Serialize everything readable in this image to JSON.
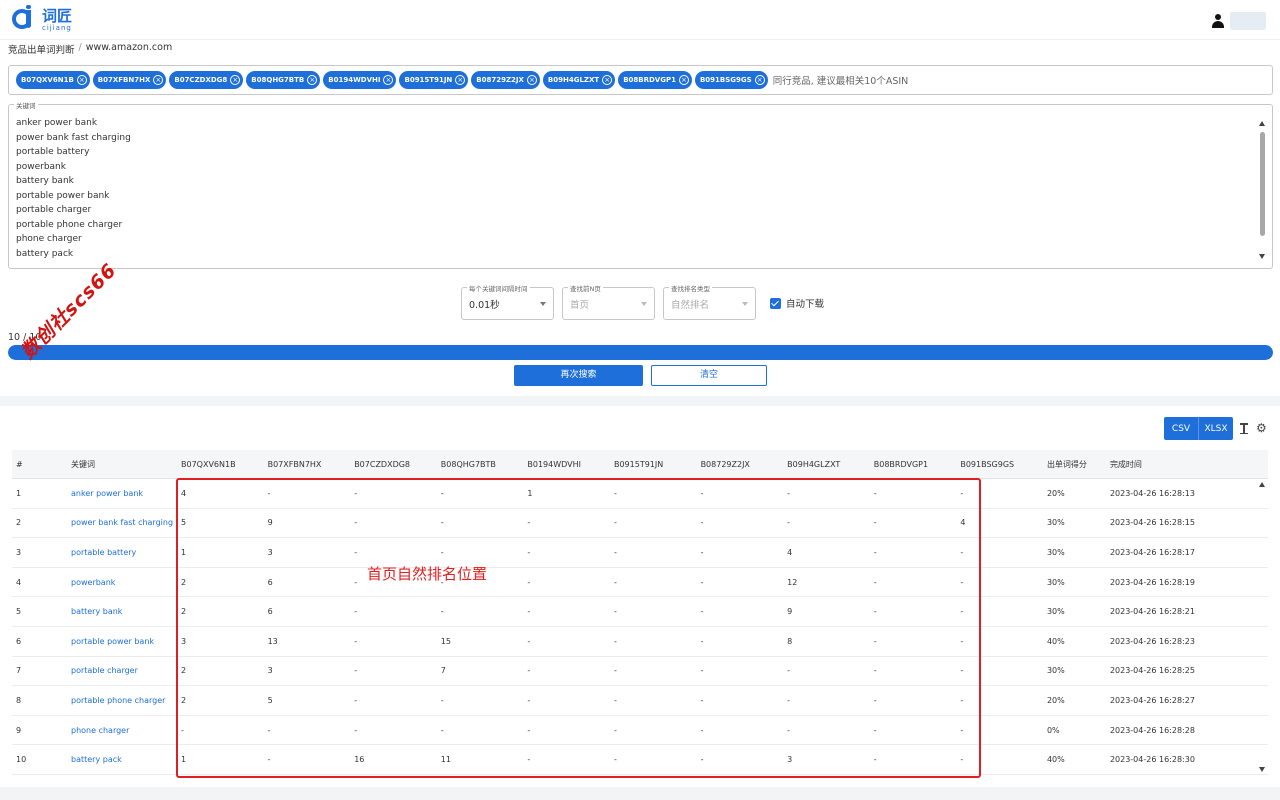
{
  "header": {
    "logo_cn": "词匠",
    "logo_en": "cijiang"
  },
  "breadcrumb": {
    "parent": "竞品出单词判断",
    "separator": "/",
    "current": "www.amazon.com"
  },
  "asins": [
    "B07QXV6N1B",
    "B07XFBN7HX",
    "B07CZDXDG8",
    "B08QHG7BTB",
    "B0194WDVHI",
    "B0915T91JN",
    "B08729Z2JX",
    "B09H4GLZXT",
    "B08BRDVGP1",
    "B091BSG9GS"
  ],
  "asin_hint": "同行竞品, 建议最相关10个ASIN",
  "keywords": {
    "legend": "关键词",
    "items": [
      "anker power bank",
      "power bank fast charging",
      "portable battery",
      "powerbank",
      "battery bank",
      "portable power bank",
      "portable charger",
      "portable phone charger",
      "phone charger",
      "battery pack"
    ]
  },
  "options": {
    "interval": {
      "label": "每个关键词间隔时间",
      "value": "0.01秒"
    },
    "pages": {
      "label": "查找前N页",
      "value": "首页"
    },
    "rank_type": {
      "label": "查找排名类型",
      "value": "自然排名"
    },
    "auto_download": {
      "label": "自动下载",
      "checked": true
    }
  },
  "progress": {
    "label": "10 / 10",
    "value": 1.0
  },
  "actions": {
    "search_again": "再次搜索",
    "clear": "清空"
  },
  "toolbar": {
    "csv": "CSV",
    "xlsx": "XLSX"
  },
  "table": {
    "headers": [
      "#",
      "关键词",
      "B07QXV6N1B",
      "B07XFBN7HX",
      "B07CZDXDG8",
      "B08QHG7BTB",
      "B0194WDVHI",
      "B0915T91JN",
      "B08729Z2JX",
      "B09H4GLZXT",
      "B08BRDVGP1",
      "B091BSG9GS",
      "出单词得分",
      "完成时间"
    ],
    "rows": [
      [
        "1",
        "anker power bank",
        "4",
        "-",
        "-",
        "-",
        "1",
        "-",
        "-",
        "-",
        "-",
        "-",
        "20%",
        "2023-04-26 16:28:13"
      ],
      [
        "2",
        "power bank fast charging",
        "5",
        "9",
        "-",
        "-",
        "-",
        "-",
        "-",
        "-",
        "-",
        "4",
        "30%",
        "2023-04-26 16:28:15"
      ],
      [
        "3",
        "portable battery",
        "1",
        "3",
        "-",
        "-",
        "-",
        "-",
        "-",
        "4",
        "-",
        "-",
        "30%",
        "2023-04-26 16:28:17"
      ],
      [
        "4",
        "powerbank",
        "2",
        "6",
        "-",
        "-",
        "-",
        "-",
        "-",
        "12",
        "-",
        "-",
        "30%",
        "2023-04-26 16:28:19"
      ],
      [
        "5",
        "battery bank",
        "2",
        "6",
        "-",
        "-",
        "-",
        "-",
        "-",
        "9",
        "-",
        "-",
        "30%",
        "2023-04-26 16:28:21"
      ],
      [
        "6",
        "portable power bank",
        "3",
        "13",
        "-",
        "15",
        "-",
        "-",
        "-",
        "8",
        "-",
        "-",
        "40%",
        "2023-04-26 16:28:23"
      ],
      [
        "7",
        "portable charger",
        "2",
        "3",
        "-",
        "7",
        "-",
        "-",
        "-",
        "-",
        "-",
        "-",
        "30%",
        "2023-04-26 16:28:25"
      ],
      [
        "8",
        "portable phone charger",
        "2",
        "5",
        "-",
        "-",
        "-",
        "-",
        "-",
        "-",
        "-",
        "-",
        "20%",
        "2023-04-26 16:28:27"
      ],
      [
        "9",
        "phone charger",
        "-",
        "-",
        "-",
        "-",
        "-",
        "-",
        "-",
        "-",
        "-",
        "-",
        "0%",
        "2023-04-26 16:28:28"
      ],
      [
        "10",
        "battery pack",
        "1",
        "-",
        "16",
        "11",
        "-",
        "-",
        "-",
        "3",
        "-",
        "-",
        "40%",
        "2023-04-26 16:28:30"
      ]
    ]
  },
  "annotation": "首页自然排名位置",
  "watermark": "数创社scs66",
  "colors": {
    "accent": "#1e6fd9",
    "annotation": "#e02020"
  }
}
